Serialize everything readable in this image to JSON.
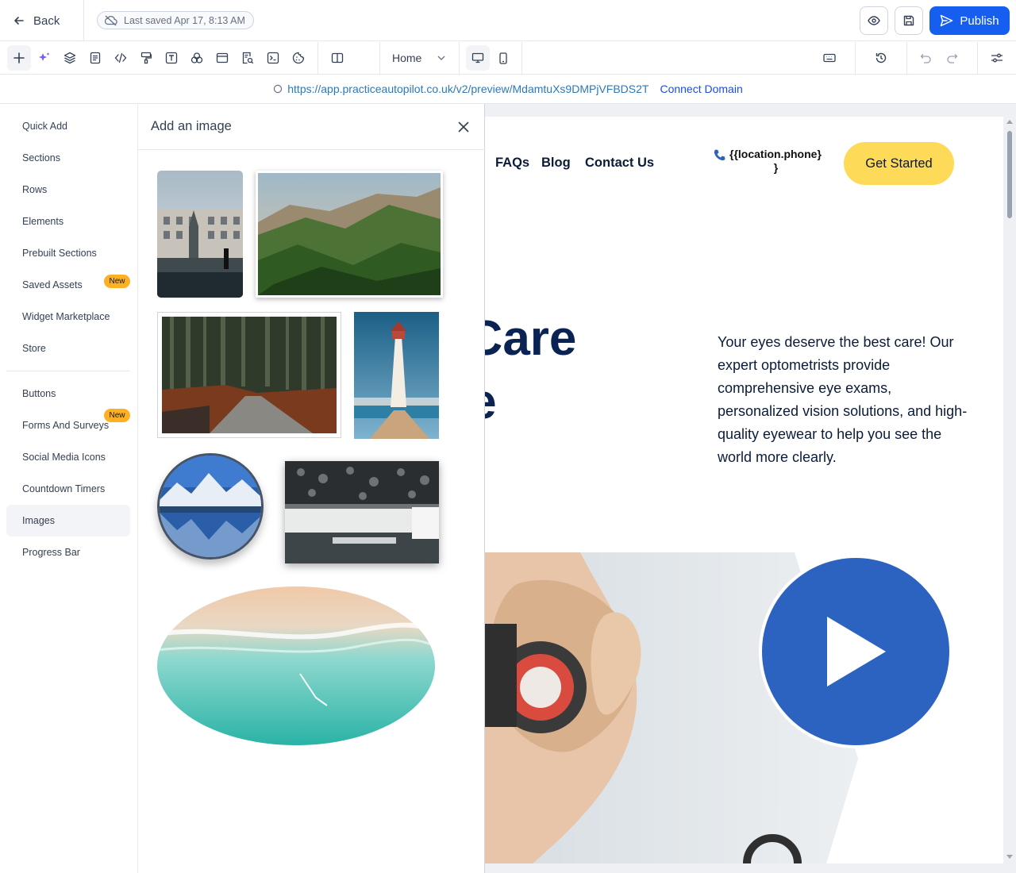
{
  "topbar": {
    "back_label": "Back",
    "last_saved": "Last saved Apr 17, 8:13 AM",
    "publish_label": "Publish"
  },
  "toolbar": {
    "page_selector": "Home"
  },
  "url_bar": {
    "url": "https://app.practiceautopilot.co.uk/v2/preview/MdamtuXs9DMPjVFBDS2T",
    "connect_label": "Connect Domain"
  },
  "sidebar": {
    "items": [
      {
        "label": "Quick Add"
      },
      {
        "label": "Sections"
      },
      {
        "label": "Rows"
      },
      {
        "label": "Elements"
      },
      {
        "label": "Prebuilt Sections"
      },
      {
        "label": "Saved Assets",
        "badge": "New"
      },
      {
        "label": "Widget Marketplace"
      },
      {
        "label": "Store"
      },
      {
        "label": "Buttons"
      },
      {
        "label": "Forms And Surveys",
        "badge": "New"
      },
      {
        "label": "Social Media Icons"
      },
      {
        "label": "Countdown Timers"
      },
      {
        "label": "Images"
      },
      {
        "label": "Progress Bar"
      }
    ]
  },
  "panel": {
    "title": "Add an image"
  },
  "preview": {
    "nav": [
      "FAQs",
      "Blog",
      "Contact Us"
    ],
    "phone": "{{location.phone}",
    "phone_tail": "}",
    "cta": "Get Started",
    "hero_line1": "Eye Care",
    "hero_line2": "re",
    "hero_paragraph": "Your eyes deserve the best care! Our expert optometrists provide comprehensive eye exams, personalized vision solutions, and high-quality eyewear to help you see the world more clearly."
  },
  "colors": {
    "publish": "#155eef",
    "badge": "#fdb022",
    "cta": "#fddb59",
    "play": "#2d63c0",
    "hero_heading": "#0b2352"
  }
}
